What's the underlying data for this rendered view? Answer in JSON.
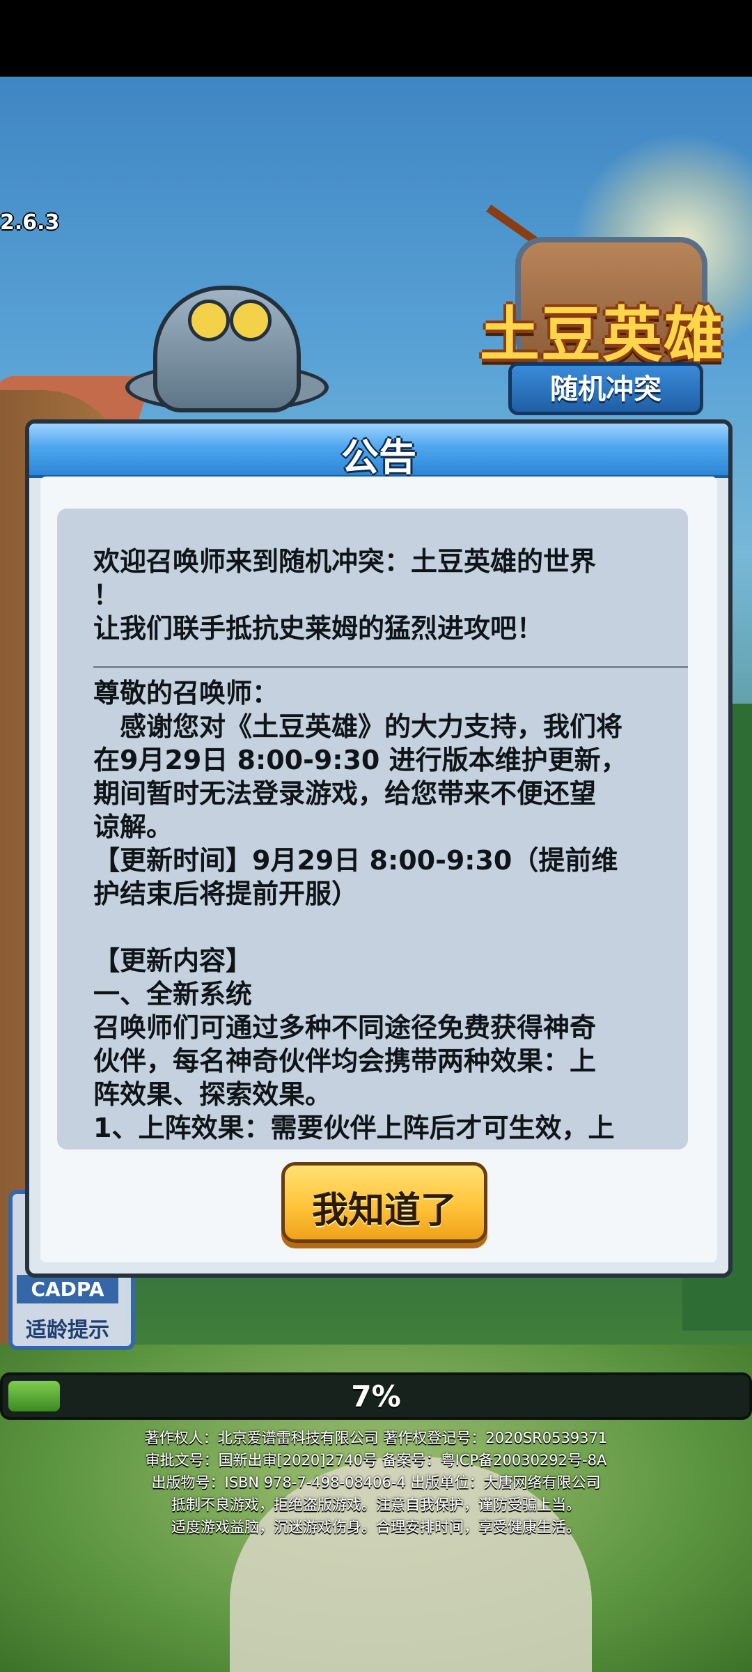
{
  "game": {
    "version": "2.6.3",
    "logo_title": "土豆英雄",
    "logo_subtitle": "随机冲突"
  },
  "dialog": {
    "title": "公告",
    "lines_intro": [
      "欢迎召唤师来到随机冲突：土豆英雄的世界",
      "！",
      "让我们联手抵抗史莱姆的猛烈进攻吧！"
    ],
    "lines_body": [
      "尊敬的召唤师：",
      "　感谢您对《土豆英雄》的大力支持，我们将",
      "在9月29日 8:00-9:30 进行版本维护更新，",
      "期间暂时无法登录游戏，给您带来不便还望",
      "谅解。",
      "【更新时间】9月29日 8:00-9:30（提前维",
      "护结束后将提前开服）"
    ],
    "lines_content": [
      "【更新内容】",
      "一、全新系统",
      "召唤师们可通过多种不同途径免费获得神奇",
      "伙伴，每名神奇伙伴均会携带两种效果：上",
      "阵效果、探索效果。",
      "1、上阵效果：需要伙伴上阵后才可生效，上"
    ],
    "ok_button": "我知道了"
  },
  "age_badge": {
    "code": "CADPA",
    "hint": "适龄提示"
  },
  "loading": {
    "percent_label": "7%",
    "progress": 0.07
  },
  "legal": [
    "著作权人：北京爱谱雷科技有限公司 著作权登记号：2020SR0539371",
    "审批文号：国新出审[2020]2740号 备案号：粤ICP备20030292号-8A",
    "出版物号：ISBN 978-7-498-08406-4 出版单位：大唐网络有限公司",
    "抵制不良游戏，拒绝盗版游戏。注意自我保护，谨防受骗上当。",
    "适度游戏益脑，沉迷游戏伤身。合理安排时间，享受健康生活。"
  ]
}
